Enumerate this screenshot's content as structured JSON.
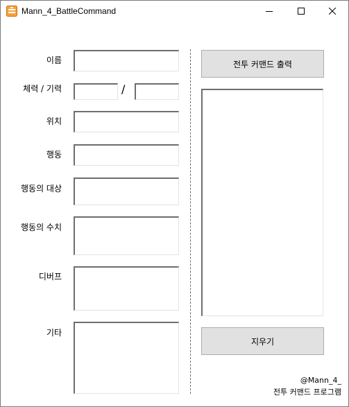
{
  "window": {
    "title": "Mann_4_BattleCommand"
  },
  "titlebar_buttons": {
    "minimize": "minimize-icon",
    "maximize": "maximize-icon",
    "close": "close-icon"
  },
  "form": {
    "name_label": "이름",
    "hp_mp_label": "체력 / 기력",
    "hp_mp_separator": "/",
    "position_label": "위치",
    "action_label": "행동",
    "action_target_label": "행동의 대상",
    "action_value_label": "행동의 수치",
    "debuff_label": "디버프",
    "etc_label": "기타"
  },
  "fields": {
    "name": "",
    "hp": "",
    "mp": "",
    "position": "",
    "action": "",
    "action_target": "",
    "action_value": "",
    "debuff": "",
    "etc": "",
    "output": ""
  },
  "right_panel": {
    "print_button_label": "전투 커맨드 출력",
    "clear_button_label": "지우기"
  },
  "footer": {
    "author": "@Mann_4_",
    "program_name": "전투 커맨드 프로그램"
  }
}
